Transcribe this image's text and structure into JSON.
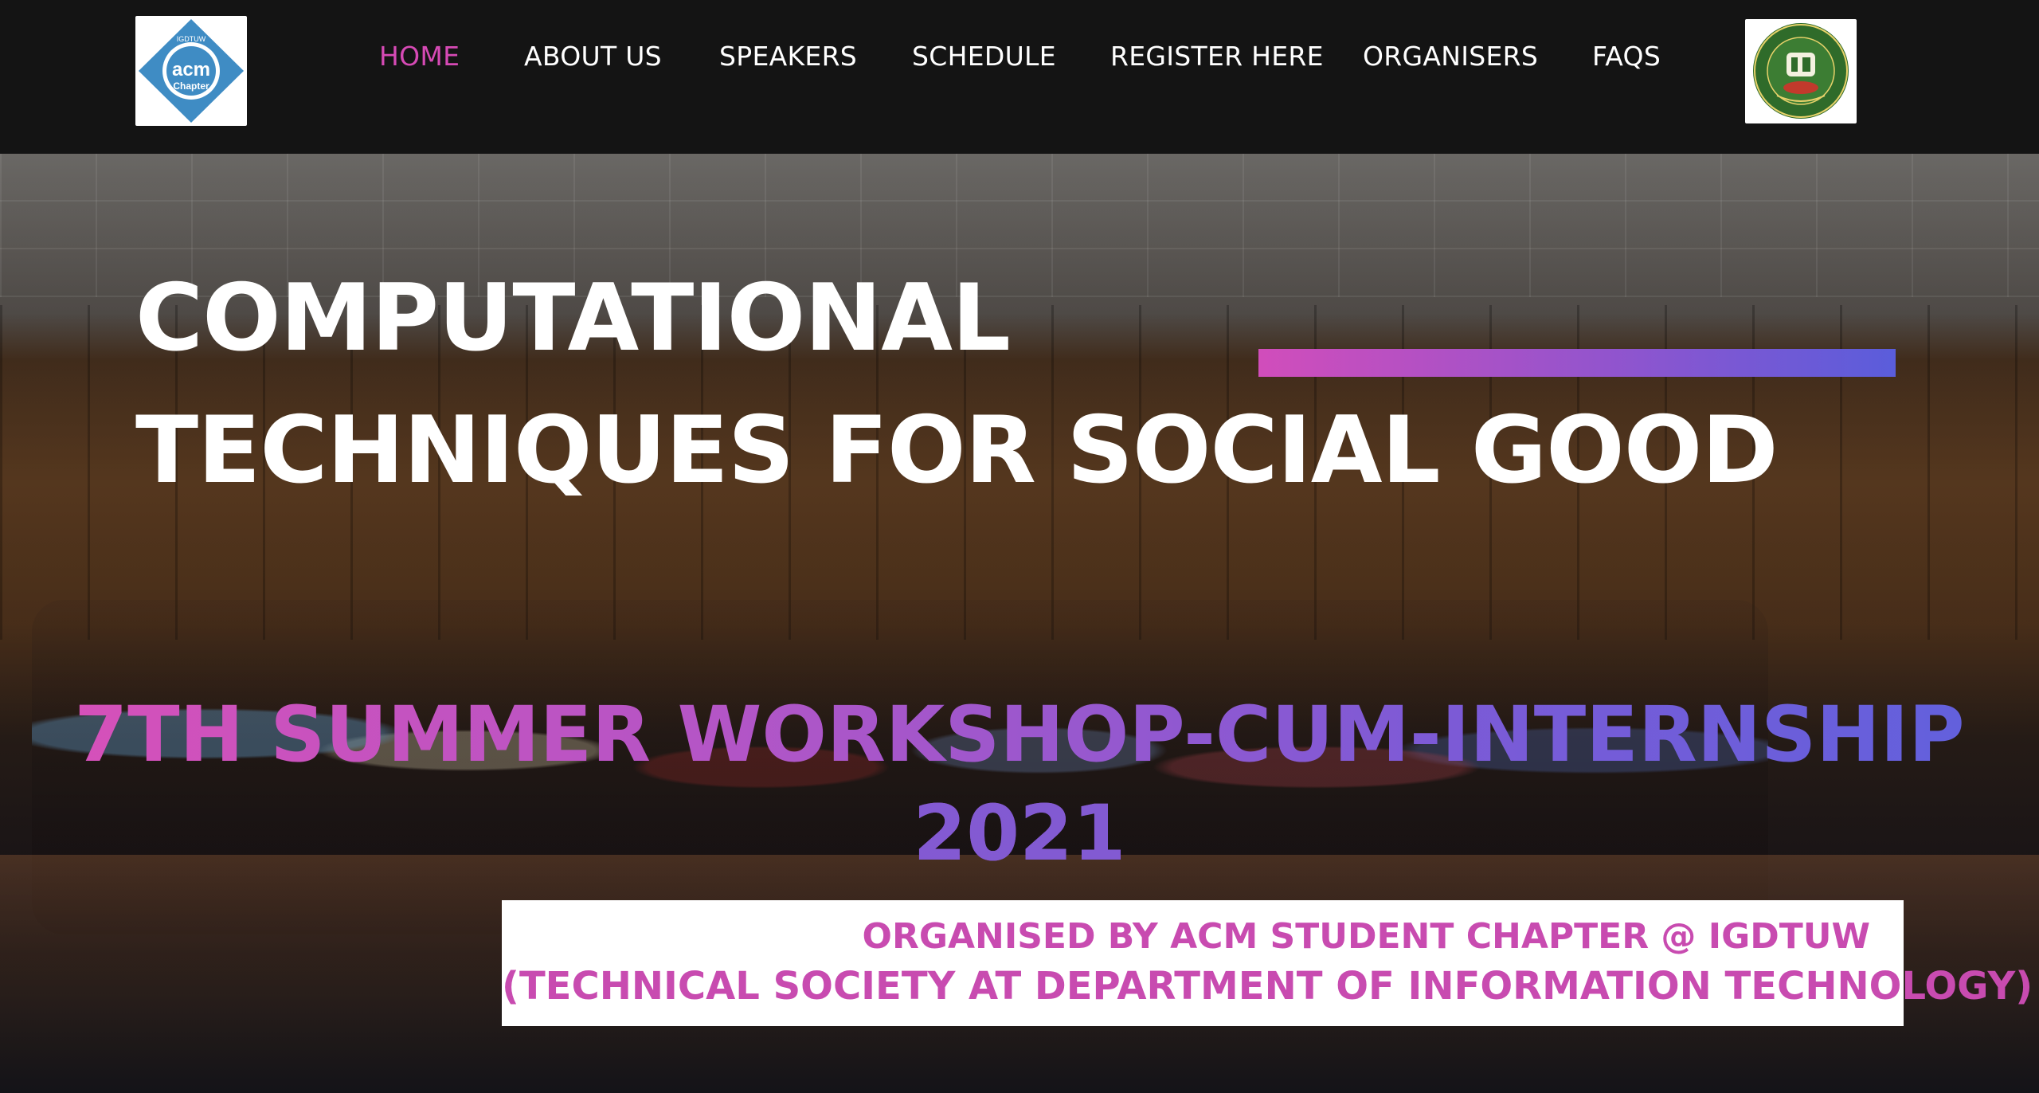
{
  "header": {
    "left_logo": {
      "top_text": "IGDTUW",
      "main_text": "acm",
      "bottom_text": "Chapter"
    },
    "nav": [
      {
        "label": "HOME",
        "active": true
      },
      {
        "label": "ABOUT US",
        "active": false
      },
      {
        "label": "SPEAKERS",
        "active": false
      },
      {
        "label": "SCHEDULE",
        "active": false
      },
      {
        "label": "REGISTER HERE",
        "active": false
      },
      {
        "label": "ORGANISERS",
        "active": false
      },
      {
        "label": "FAQS",
        "active": false
      }
    ]
  },
  "hero": {
    "title_line1": "COMPUTATIONAL",
    "title_line2": "TECHNIQUES FOR SOCIAL GOOD",
    "subtitle_line1": "7TH SUMMER WORKSHOP-CUM-INTERNSHIP",
    "subtitle_line2": "2021",
    "organised_line1": "ORGANISED BY ACM STUDENT CHAPTER @ IGDTUW",
    "organised_line2": "(TECHNICAL SOCIETY AT DEPARTMENT OF INFORMATION TECHNOLOGY)"
  },
  "colors": {
    "nav_active": "#d64ab5",
    "header_bg": "#141414",
    "gradient_start": "#d14dbb",
    "gradient_end": "#5a5ddb",
    "org_text": "#c84bb0"
  },
  "icons": {
    "left_logo": "acm-chapter-logo",
    "right_logo": "igdtuw-university-seal"
  }
}
